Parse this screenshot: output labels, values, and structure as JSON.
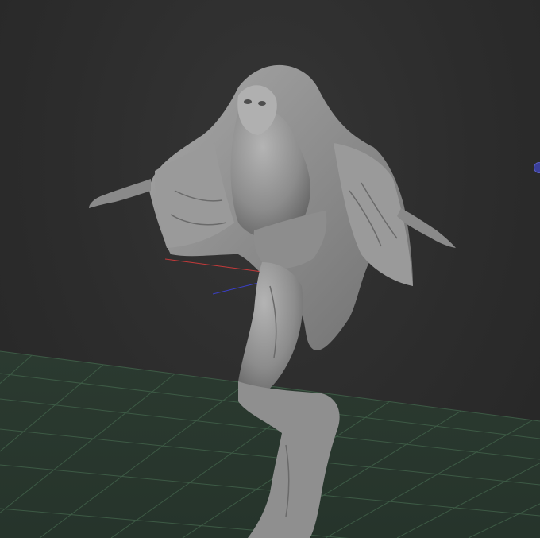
{
  "viewport": {
    "background": "#2b2b2b",
    "grid_color": "#3d5a45",
    "floor_color": "#2c3a31",
    "model_color": "#8e8e8e"
  },
  "axes": {
    "x_color": "#c43a3a",
    "y_color": "#3fbf4a",
    "z_color": "#3a3fc4"
  },
  "icons": {
    "gizmo": "navigation-gizmo-dot"
  }
}
